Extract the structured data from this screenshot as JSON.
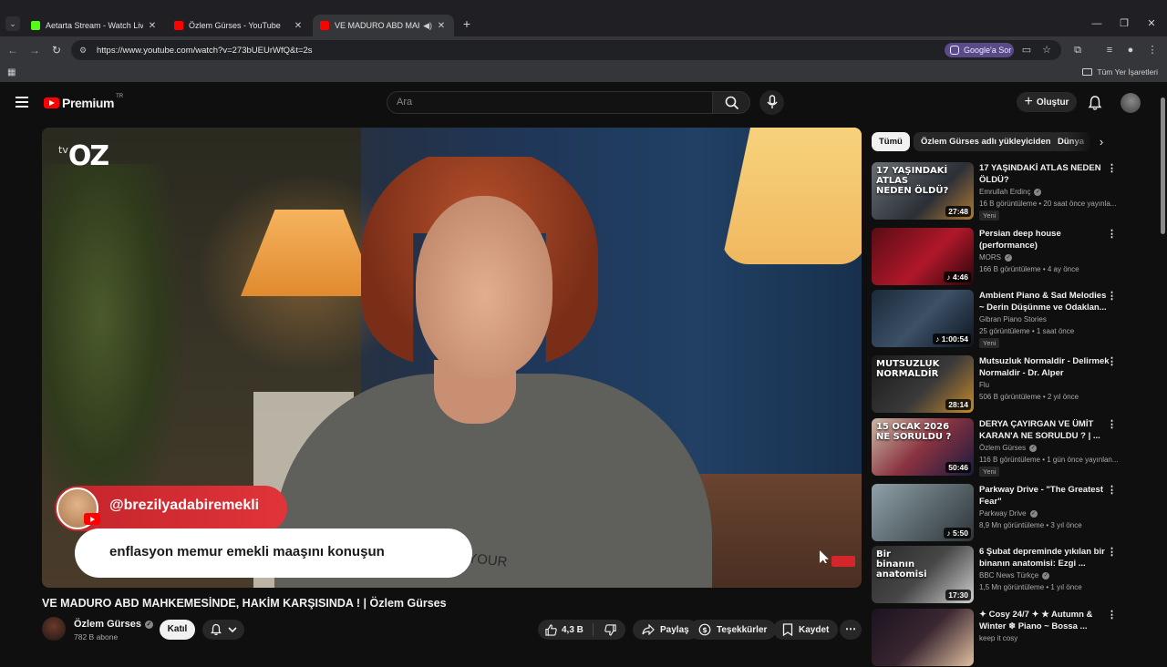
{
  "browser": {
    "tabs": [
      {
        "title": "Aetarta Stream - Watch Live on",
        "favicon_color": "#53fc18"
      },
      {
        "title": "Özlem Gürses - YouTube",
        "favicon_color": "#ff0000"
      },
      {
        "title": "VE MADURO ABD MAHKEMESİ",
        "favicon_color": "#ff0000"
      }
    ],
    "new_tab": "+",
    "url": "https://www.youtube.com/watch?v=273bUEUrWfQ&t=2s",
    "google_ask": "Google'a Sor",
    "all_bookmarks": "Tüm Yer İşaretleri"
  },
  "youtube": {
    "logo": "Premium",
    "country": "TR",
    "search_placeholder": "Ara",
    "create_label": "Oluştur"
  },
  "video": {
    "tv_logo_small": "tv",
    "tv_logo": "OZ",
    "overlay_handle": "@brezilyadabiremekli",
    "overlay_caption": "enflasyon memur emekli maaşını konuşun",
    "shirt_text": "RM YOUR",
    "title": "VE MADURO ABD MAHKEMESİNDE, HAKİM KARŞISINDA ! | Özlem Gürses",
    "channel": "Özlem Gürses",
    "subscribers": "782 B abone",
    "join": "Katıl",
    "likes": "4,3 B",
    "share": "Paylaş",
    "thanks": "Teşekkürler",
    "save": "Kaydet",
    "more": "⋯"
  },
  "chips": [
    "Tümü",
    "Özlem Gürses adlı yükleyiciden",
    "Dünya"
  ],
  "recommendations": [
    {
      "title": "17 YAŞINDAKİ ATLAS NEDEN ÖLDÜ?",
      "channel": "Emrullah Erdinç",
      "verified": true,
      "meta": "16 B görüntüleme • 20 saat önce yayınla...",
      "badge": "Yeni",
      "duration": "27:48",
      "thumb_text": "17 YAŞINDAKİ\nATLAS\nNEDEN ÖLDÜ?",
      "thumb_bg": "linear-gradient(135deg,#6a6f76,#2b2f36 60%,#b07a34)"
    },
    {
      "title": "Persian deep house (performance)",
      "channel": "MORS",
      "verified": true,
      "meta": "166 B görüntüleme • 4 ay önce",
      "badge": "",
      "duration": "♪ 4:46",
      "thumb_text": "",
      "thumb_bg": "linear-gradient(135deg,#5a0c14,#b0182a 55%,#2a0509)"
    },
    {
      "title": "Ambient Piano & Sad Melodies ~ Derin Düşünme ve Odaklan...",
      "channel": "Gibran Piano Stories",
      "verified": false,
      "meta": "25 görüntüleme • 1 saat önce",
      "badge": "Yeni",
      "duration": "♪ 1:00:54",
      "thumb_text": "",
      "thumb_bg": "linear-gradient(135deg,#1b2a3a,#3c5066 50%,#0d1520)"
    },
    {
      "title": "Mutsuzluk Normaldir - Delirmek Normaldir - Dr. Alper Hasanoğl...",
      "channel": "Flu",
      "verified": false,
      "meta": "506 B görüntüleme • 2 yıl önce",
      "badge": "",
      "duration": "28:14",
      "thumb_text": "MUTSUZLUK\nNORMALDİR",
      "thumb_bg": "linear-gradient(135deg,#1a1a1a,#3a3a3a 55%,#c68a2a)"
    },
    {
      "title": "DERYA ÇAYIRGAN VE ÜMİT KARAN'A NE SORULDU ? | ...",
      "channel": "Özlem Gürses",
      "verified": true,
      "meta": "116 B görüntüleme • 1 gün önce yayınlan...",
      "badge": "Yeni",
      "duration": "50:46",
      "thumb_text": "15 OCAK 2026\nNE SORULDU ?",
      "thumb_bg": "linear-gradient(135deg,#c9b9a6,#8a3340 50%,#1a1a40)"
    },
    {
      "title": "Parkway Drive - \"The Greatest Fear\"",
      "channel": "Parkway Drive",
      "verified": true,
      "meta": "8,9 Mn görüntüleme • 3 yıl önce",
      "badge": "",
      "duration": "♪ 5:50",
      "thumb_text": "",
      "thumb_bg": "linear-gradient(135deg,#8fa0a8,#5d6a70 50%,#2e3538)"
    },
    {
      "title": "6 Şubat depreminde yıkılan bir binanın anatomisi: Ezgi ...",
      "channel": "BBC News Türkçe",
      "verified": true,
      "meta": "1,5 Mn görüntüleme • 1 yıl önce",
      "badge": "",
      "duration": "17:30",
      "thumb_text": "Bir\nbinanın\nanatomisi",
      "thumb_bg": "linear-gradient(135deg,#2a2a2a,#474747 50%,#d0d0d0)"
    },
    {
      "title": "✦ Cosy 24/7 ✦ ★ Autumn & Winter ❄ Piano ~ Bossa ...",
      "channel": "keep it cosy",
      "verified": false,
      "meta": "",
      "badge": "",
      "duration": "",
      "thumb_text": "",
      "thumb_bg": "linear-gradient(135deg,#1a1420,#3a2630 50%,#e0c0a0)"
    }
  ]
}
